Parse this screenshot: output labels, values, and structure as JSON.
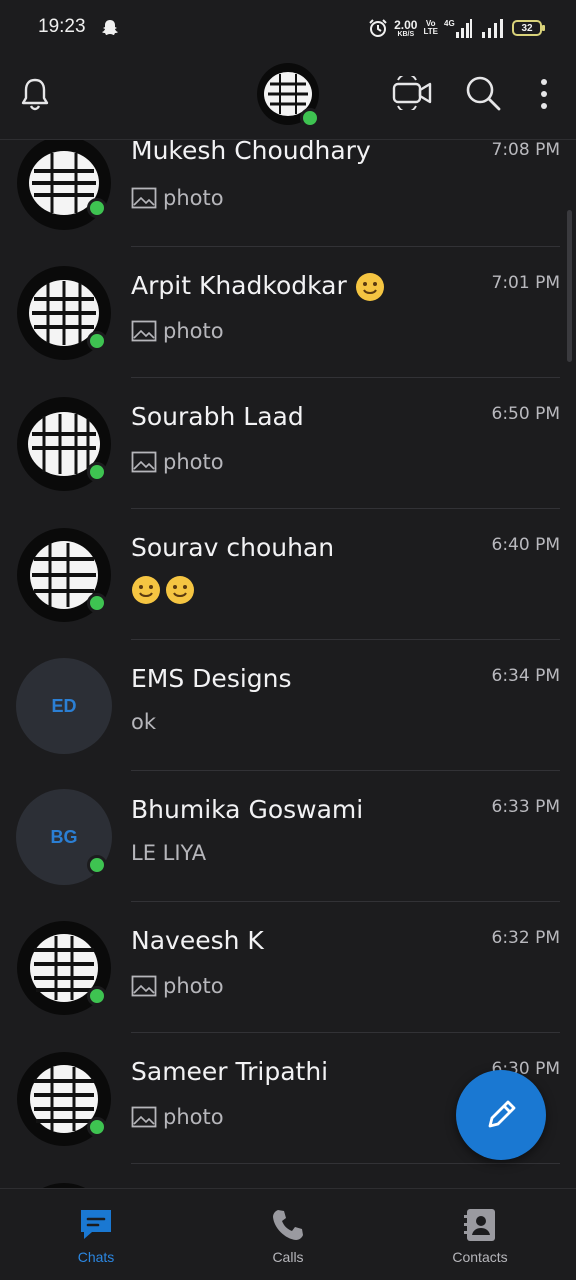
{
  "status_bar": {
    "time": "19:23",
    "net_speed_value": "2.00",
    "net_speed_unit": "KB/S",
    "volte_top": "Vo",
    "volte_bottom": "LTE",
    "network_type": "4G",
    "battery": "32"
  },
  "header": {
    "icons": [
      "bell-icon",
      "video-call-icon",
      "search-icon",
      "more-icon"
    ]
  },
  "chats": [
    {
      "name": "Mukesh Choudhary",
      "time": "7:08 PM",
      "preview": "photo",
      "preview_type": "photo",
      "online": true
    },
    {
      "name": "Arpit Khadkodkar",
      "time": "7:01 PM",
      "preview": "photo",
      "preview_type": "photo",
      "online": true
    },
    {
      "name": "Sourabh Laad",
      "time": "6:50 PM",
      "preview": "photo",
      "preview_type": "photo",
      "online": true
    },
    {
      "name": "Sourav chouhan",
      "time": "6:40 PM",
      "preview": "",
      "preview_type": "emoji",
      "online": true
    },
    {
      "name": "EMS Designs",
      "time": "6:34 PM",
      "preview": "ok",
      "preview_type": "text",
      "initials": "ED",
      "online": false
    },
    {
      "name": "Bhumika Goswami",
      "time": "6:33 PM",
      "preview": "LE LIYA",
      "preview_type": "text",
      "initials": "BG",
      "online": true
    },
    {
      "name": "Naveesh K",
      "time": "6:32 PM",
      "preview": "photo",
      "preview_type": "photo",
      "online": true
    },
    {
      "name": "Sameer Tripathi",
      "time": "6:30 PM",
      "preview": "photo",
      "preview_type": "photo",
      "online": true
    }
  ],
  "bottom_nav": {
    "chats": "Chats",
    "calls": "Calls",
    "contacts": "Contacts",
    "active": "Chats"
  },
  "colors": {
    "background": "#1c1c1e",
    "accent": "#1a78d2",
    "online": "#3ec351",
    "emoji": "#f5c542"
  }
}
